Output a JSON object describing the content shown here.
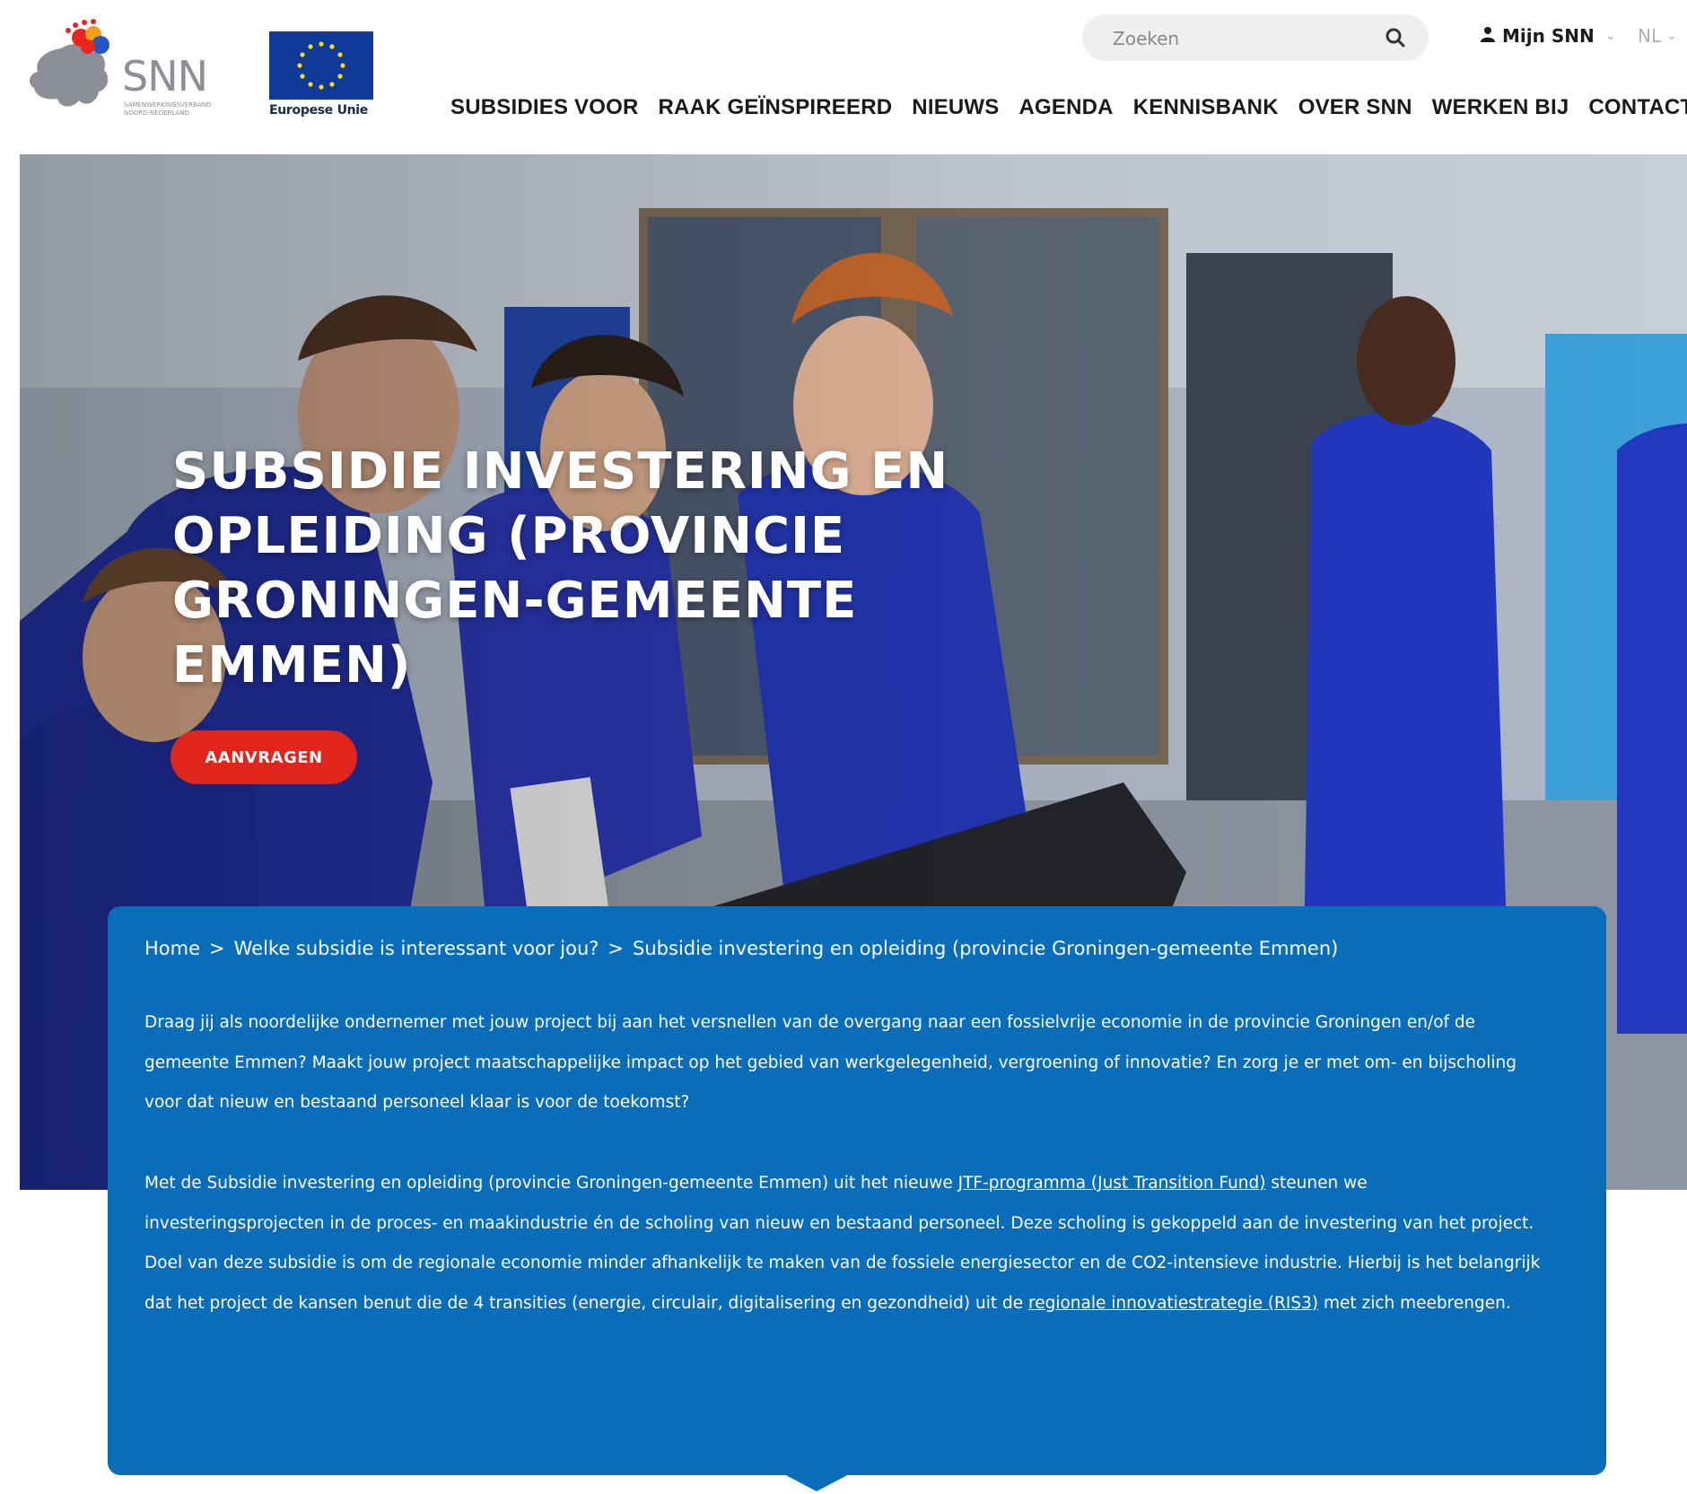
{
  "header": {
    "logo_text": "SNN",
    "logo_subtitle_1": "SAMENWERKINGSVERBAND",
    "logo_subtitle_2": "NOORD-NEDERLAND",
    "eu_label": "Europese Unie",
    "search": {
      "placeholder": "Zoeken"
    },
    "account_label": "Mijn SNN",
    "language": "NL",
    "nav": [
      "SUBSIDIES VOOR",
      "RAAK GEÏNSPIREERD",
      "NIEUWS",
      "AGENDA",
      "KENNISBANK",
      "OVER SNN",
      "WERKEN BIJ",
      "CONTACT"
    ]
  },
  "hero": {
    "title": "SUBSIDIE INVESTERING EN OPLEIDING (PROVINCIE GRONINGEN-GEMEENTE EMMEN)",
    "apply_button": "AANVRAGEN"
  },
  "breadcrumb": {
    "items": [
      "Home",
      "Welke subsidie is interessant voor jou?",
      "Subsidie investering en opleiding (provincie Groningen-gemeente Emmen)"
    ],
    "separator": ">"
  },
  "content": {
    "paragraph_1": "Draag jij als noordelijke ondernemer met jouw project bij aan het versnellen van de overgang naar een fossielvrije economie in de provincie Groningen en/of de gemeente Emmen? Maakt jouw project maatschappelijke impact op het gebied van werkgelegenheid, vergroening of innovatie? En zorg je er met om- en bijscholing voor dat nieuw en bestaand personeel klaar is voor de toekomst?",
    "paragraph_2_before_link": "Met de Subsidie investering en opleiding (provincie Groningen-gemeente Emmen) uit het nieuwe ",
    "paragraph_2_link_1": "JTF-programma (Just Transition Fund)",
    "paragraph_2_middle": " steunen we investeringsprojecten in de proces- en maakindustrie én de scholing van nieuw en bestaand personeel. Deze scholing is gekoppeld aan de investering van het project. Doel van deze subsidie is om de regionale economie minder afhankelijk te maken van de fossiele energiesector en de CO2-intensieve industrie. Hierbij is het belangrijk dat het project de kansen benut die de 4 transities (energie, circulair, digitalisering en gezondheid) uit de ",
    "paragraph_2_link_2": "regionale innovatiestrategie (RIS3)",
    "paragraph_2_after_link": " met zich meebrengen."
  },
  "colors": {
    "panel_blue": "#0a6db9",
    "button_red": "#e0261c",
    "eu_blue": "#0f3a99",
    "eu_star_yellow": "#ffdd00"
  }
}
